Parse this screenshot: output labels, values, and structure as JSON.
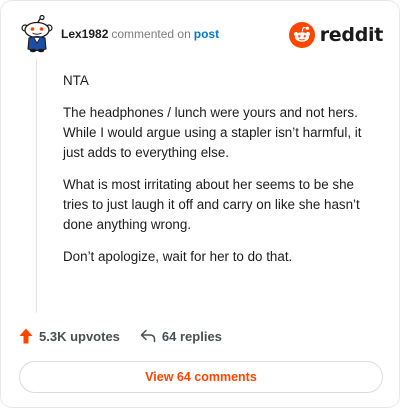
{
  "header": {
    "username": "Lex1982",
    "action_text": "commented on",
    "target_text": "post",
    "brand_name": "reddit",
    "brand_color": "#ff4500",
    "avatar_icon": "snoo-avatar-icon"
  },
  "comment": {
    "paragraphs": [
      "NTA",
      "The headphones / lunch were yours and not hers. While I would argue using a stapler isn’t harmful, it just adds to everything else.",
      "What is most irritating about her seems to be she tries to just laugh it off and carry on like she hasn’t done anything wrong.",
      "Don’t apologize, wait for her to do that."
    ]
  },
  "stats": {
    "upvotes_label": "5.3K upvotes",
    "replies_label": "64 replies",
    "upvote_icon": "upvote-arrow-icon",
    "reply_icon": "reply-arrow-icon",
    "upvote_color": "#ff4500"
  },
  "footer": {
    "view_button_label": "View 64 comments"
  }
}
